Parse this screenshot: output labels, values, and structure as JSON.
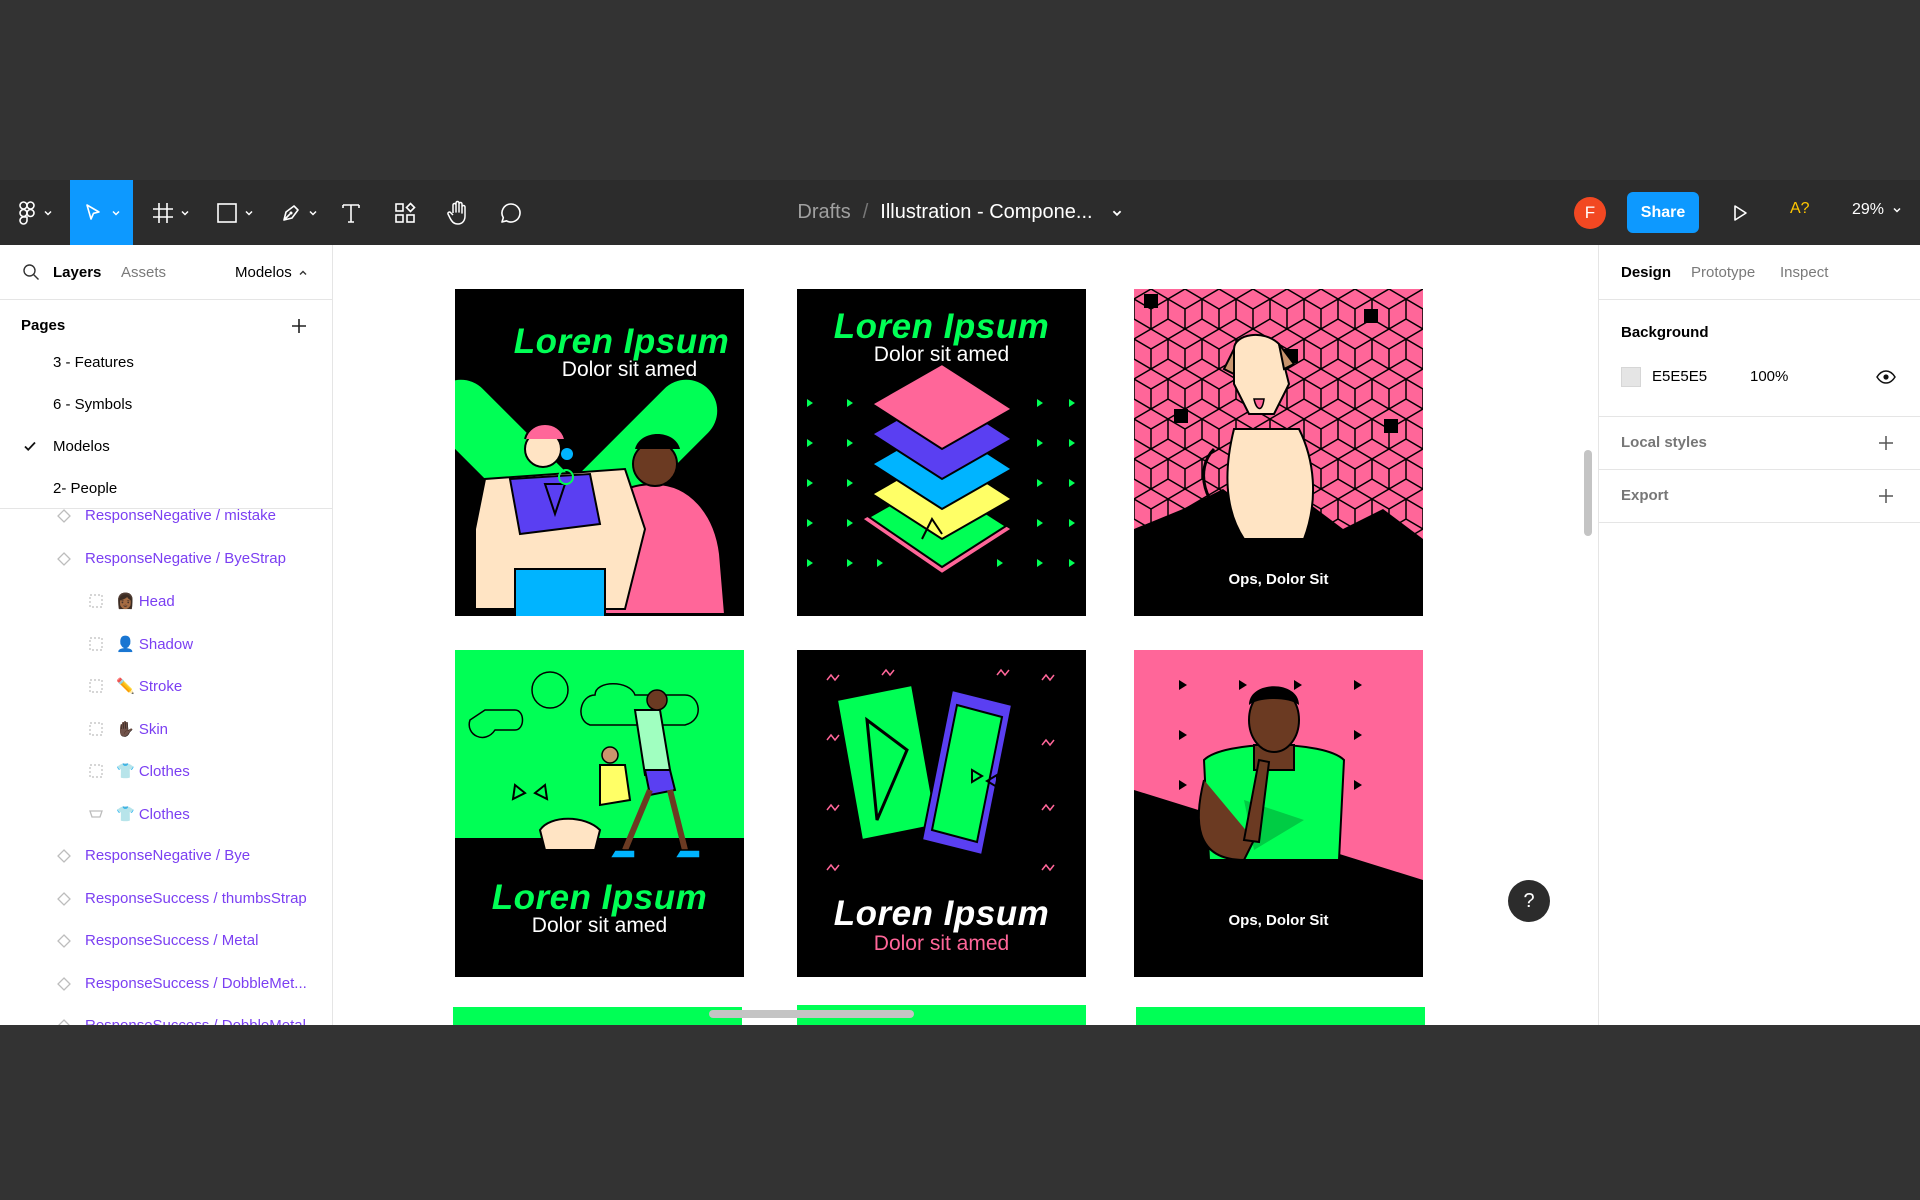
{
  "toolbar": {
    "breadcrumb_folder": "Drafts",
    "breadcrumb_sep": "/",
    "file_name": "Illustration - Compone...",
    "avatar_initial": "F",
    "share_label": "Share",
    "a11y_label": "A?",
    "zoom_label": "29%"
  },
  "left_panel": {
    "tabs": [
      "Layers",
      "Assets"
    ],
    "current_page": "Modelos",
    "pages_title": "Pages",
    "pages": [
      {
        "label": "3 - Features",
        "checked": false
      },
      {
        "label": "6 - Symbols",
        "checked": false
      },
      {
        "label": "Modelos",
        "checked": true
      },
      {
        "label": "2- People",
        "checked": false
      }
    ],
    "layers": [
      {
        "label": "ResponseNegative / mistake",
        "type": "component"
      },
      {
        "label": "ResponseNegative / ByeStrap",
        "type": "component"
      },
      {
        "label": "👩🏾 Head",
        "type": "frame"
      },
      {
        "label": "👤 Shadow",
        "type": "frame"
      },
      {
        "label": "✏️ Stroke",
        "type": "frame"
      },
      {
        "label": "✋🏿 Skin",
        "type": "frame"
      },
      {
        "label": "👕 Clothes",
        "type": "frame"
      },
      {
        "label": "👕 Clothes",
        "type": "instance"
      },
      {
        "label": "ResponseNegative / Bye",
        "type": "component"
      },
      {
        "label": "ResponseSuccess / thumbsStrap",
        "type": "component"
      },
      {
        "label": "ResponseSuccess / Metal",
        "type": "component"
      },
      {
        "label": "ResponseSuccess / DobbleMet...",
        "type": "component"
      },
      {
        "label": "ResponseSuccess / DobbleMetal",
        "type": "component"
      }
    ]
  },
  "canvas": {
    "cards": [
      {
        "title": "Loren Ipsum",
        "subtitle": "Dolor sit amed"
      },
      {
        "title": "Loren Ipsum",
        "subtitle": "Dolor sit amed"
      },
      {
        "caption": "Ops, Dolor Sit"
      },
      {
        "title": "Loren Ipsum",
        "subtitle": "Dolor sit amed"
      },
      {
        "title": "Loren Ipsum",
        "subtitle": "Dolor sit amed"
      },
      {
        "caption": "Ops, Dolor Sit"
      }
    ]
  },
  "right_panel": {
    "tabs": [
      "Design",
      "Prototype",
      "Inspect"
    ],
    "background_title": "Background",
    "background_hex": "E5E5E5",
    "background_opacity": "100%",
    "local_styles_label": "Local styles",
    "export_label": "Export"
  },
  "help_label": "?",
  "colors": {
    "accent_blue": "#0d99ff",
    "neon_green": "#00ff55",
    "hot_pink": "#ff6699",
    "component_purple": "#7b3ff2",
    "toolbar_bg": "#2c2c2c"
  },
  "icons": [
    "figma-menu-icon",
    "move-tool-icon",
    "frame-tool-icon",
    "rectangle-tool-icon",
    "pen-tool-icon",
    "text-tool-icon",
    "components-icon",
    "hand-tool-icon",
    "comment-icon",
    "chevron-down-icon",
    "play-icon",
    "search-icon",
    "plus-icon",
    "checkmark-icon",
    "component-icon",
    "frame-icon",
    "instance-icon",
    "eye-icon"
  ]
}
